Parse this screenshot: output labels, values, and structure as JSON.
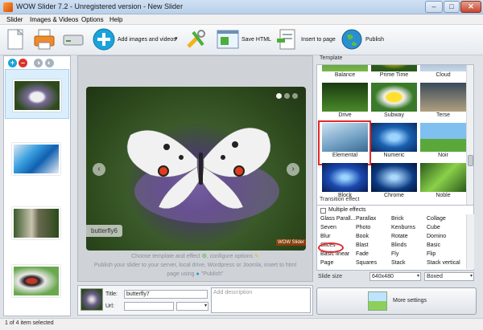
{
  "window": {
    "title": "WOW Slider 7.2 - Unregistered version - New Slider"
  },
  "menu": [
    "Slider",
    "Images & Videos",
    "Options",
    "Help"
  ],
  "toolbar": {
    "add_images": "Add images and videos",
    "save_html": "Save HTML",
    "insert_to_page": "Insert to page",
    "publish": "Publish"
  },
  "thumbnails": [
    {
      "name": "butterfly-thumb-1",
      "selected": true
    },
    {
      "name": "butterfly-thumb-2",
      "selected": false
    },
    {
      "name": "butterfly-thumb-3",
      "selected": false
    },
    {
      "name": "butterfly-thumb-4",
      "selected": false
    }
  ],
  "preview": {
    "caption": "butterfly6",
    "watermark": "WOW Slider",
    "hint_line1": "Choose template and effect",
    "hint_line1b": ", configure options",
    "hint_line2": "Publish your slider to your server, local drive, Wordpress or Joomla, insert to html",
    "hint_line3": "page using",
    "hint_line3b": "\"Publish\""
  },
  "slide": {
    "title_label": "Title:",
    "title_value": "butterfly7",
    "url_label": "Url:",
    "description_placeholder": "Add description"
  },
  "template": {
    "group_label": "Template",
    "items": [
      {
        "name": "Balance"
      },
      {
        "name": "Prime Time"
      },
      {
        "name": "Cloud"
      },
      {
        "name": "Drive"
      },
      {
        "name": "Subway"
      },
      {
        "name": "Terse"
      },
      {
        "name": "Elemental"
      },
      {
        "name": "Numeric"
      },
      {
        "name": "Noir"
      },
      {
        "name": "Block"
      },
      {
        "name": "Chrome"
      },
      {
        "name": "Noble"
      }
    ],
    "selected": "Elemental"
  },
  "effects": {
    "group_label": "Transition effect",
    "multiple_label": "Multiple effects",
    "columns": [
      [
        "Glass Parall...",
        "Seven",
        "Blur",
        "Slices",
        "Basic linear",
        "Page"
      ],
      [
        "Parallax",
        "Photo",
        "Book",
        "Blast",
        "Fade",
        "Squares"
      ],
      [
        "Brick",
        "Kenburns",
        "Rotate",
        "Blinds",
        "Fly",
        "Stack"
      ],
      [
        "Collage",
        "Cube",
        "Domino",
        "Basic",
        "Flip",
        "Stack vertical"
      ]
    ],
    "selected": "Slices"
  },
  "slide_size": {
    "label": "Slide size",
    "value": "640x480",
    "mode": "Boxed"
  },
  "more_settings": "More settings",
  "status": "1 of 4 item selected",
  "colors": {
    "accent": "#e02a2a",
    "add_button": "#1aa3d9"
  }
}
